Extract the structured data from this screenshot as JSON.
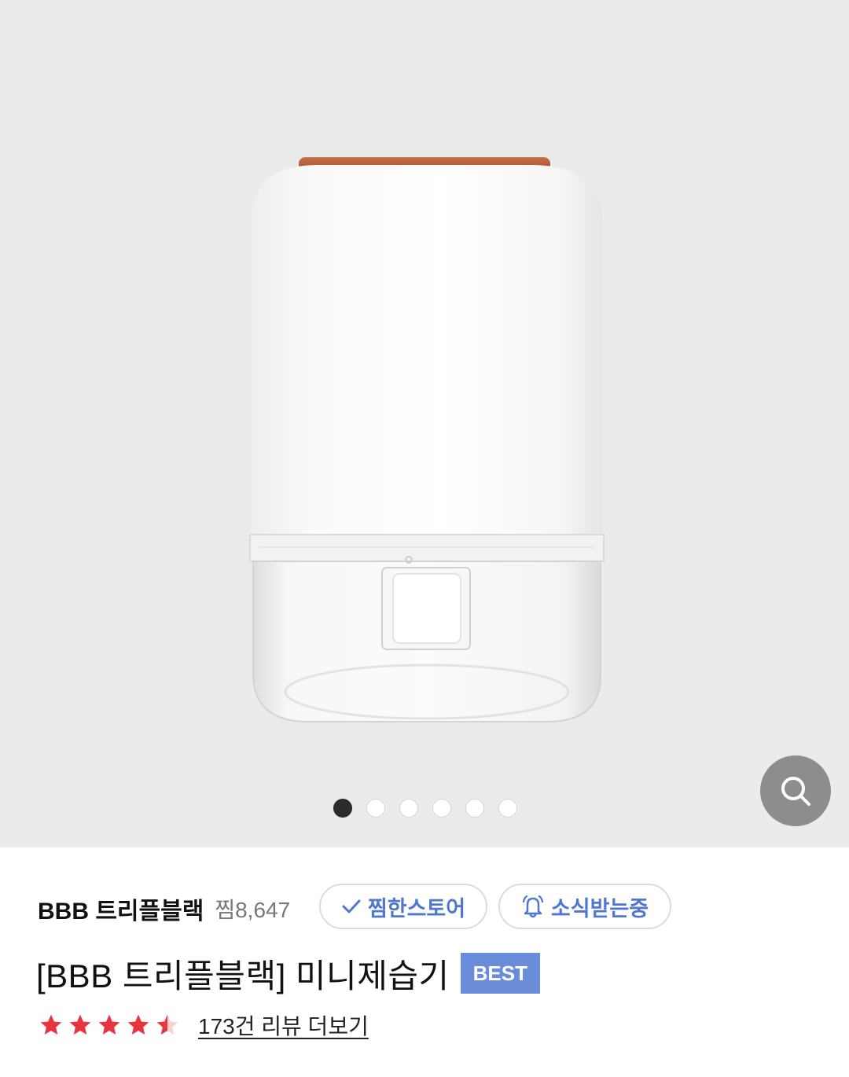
{
  "gallery": {
    "image_count": 6,
    "active_index": 0,
    "background_color": "#ebebeb",
    "zoom_icon": "search-icon"
  },
  "store": {
    "name": "BBB 트리플블랙",
    "wish_count": "찜8,647",
    "wish_button_label": "찜한스토어",
    "wish_button_icon": "check-icon",
    "news_button_label": "소식받는중",
    "news_button_icon": "bell-icon",
    "accent_color": "#4f77cf"
  },
  "product": {
    "title": "[BBB 트리플블랙] 미니제습기",
    "badge": "BEST",
    "badge_color": "#6b8dd9",
    "rating": 4.5,
    "rating_max": 5,
    "star_color": "#e8343f",
    "review_link": "173건 리뷰 더보기"
  }
}
